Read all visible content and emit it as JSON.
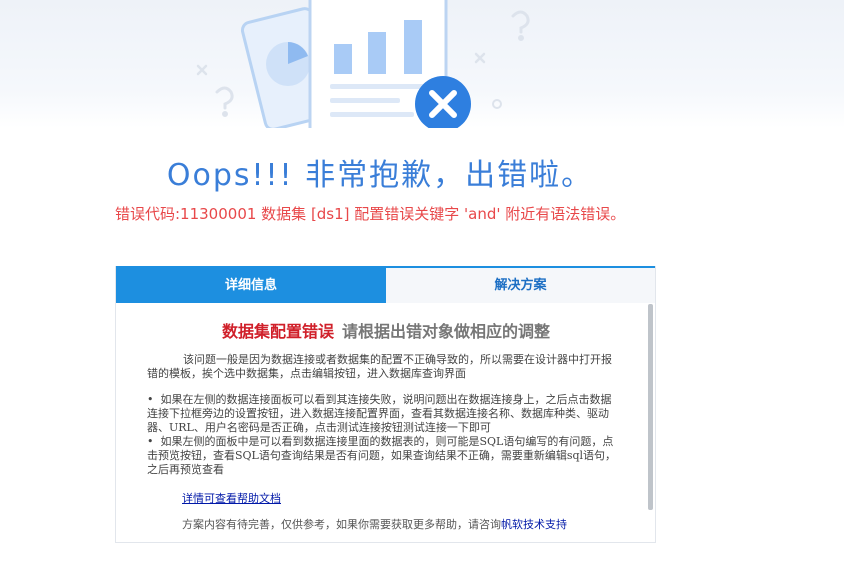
{
  "title": "Oops!!! 非常抱歉，出错啦。",
  "error_message": "错误代码:11300001 数据集 [ds1] 配置错误关键字 'and' 附近有语法错误。",
  "tabs": [
    {
      "label": "详细信息",
      "active": true
    },
    {
      "label": "解决方案",
      "active": false
    }
  ],
  "detail": {
    "heading_red": "数据集配置错误",
    "heading_grey": "请根据出错对象做相应的调整",
    "intro": "该问题一般是因为数据连接或者数据集的配置不正确导致的，所以需要在设计器中打开报错的模板，挨个选中数据集，点击编辑按钮，进入数据库查询界面",
    "bullets": [
      "如果在左侧的数据连接面板可以看到其连接失败，说明问题出在数据连接身上，之后点击数据连接下拉框旁边的设置按钮，进入数据连接配置界面，查看其数据连接名称、数据库种类、驱动器、URL、用户名密码是否正确，点击测试连接按钮测试连接一下即可",
      "如果左侧的面板中是可以看到数据连接里面的数据表的，则可能是SQL语句编写的有问题，点击预览按钮，查看SQL语句查询结果是否有问题，如果查询结果不正确，需要重新编辑sql语句，之后再预览查看"
    ],
    "help_link": "详情可查看帮助文档",
    "footer_text": "方案内容有待完善，仅供参考，如果你需要获取更多帮助，请咨询",
    "footer_link": "帆软技术支持"
  },
  "colors": {
    "accent": "#1d8fe0",
    "error": "#e8484a",
    "title": "#3a7ed8"
  },
  "icons": [
    "clipboard-chart-icon",
    "pie-chart-card-icon",
    "close-circle-icon",
    "question-mark-icon"
  ]
}
